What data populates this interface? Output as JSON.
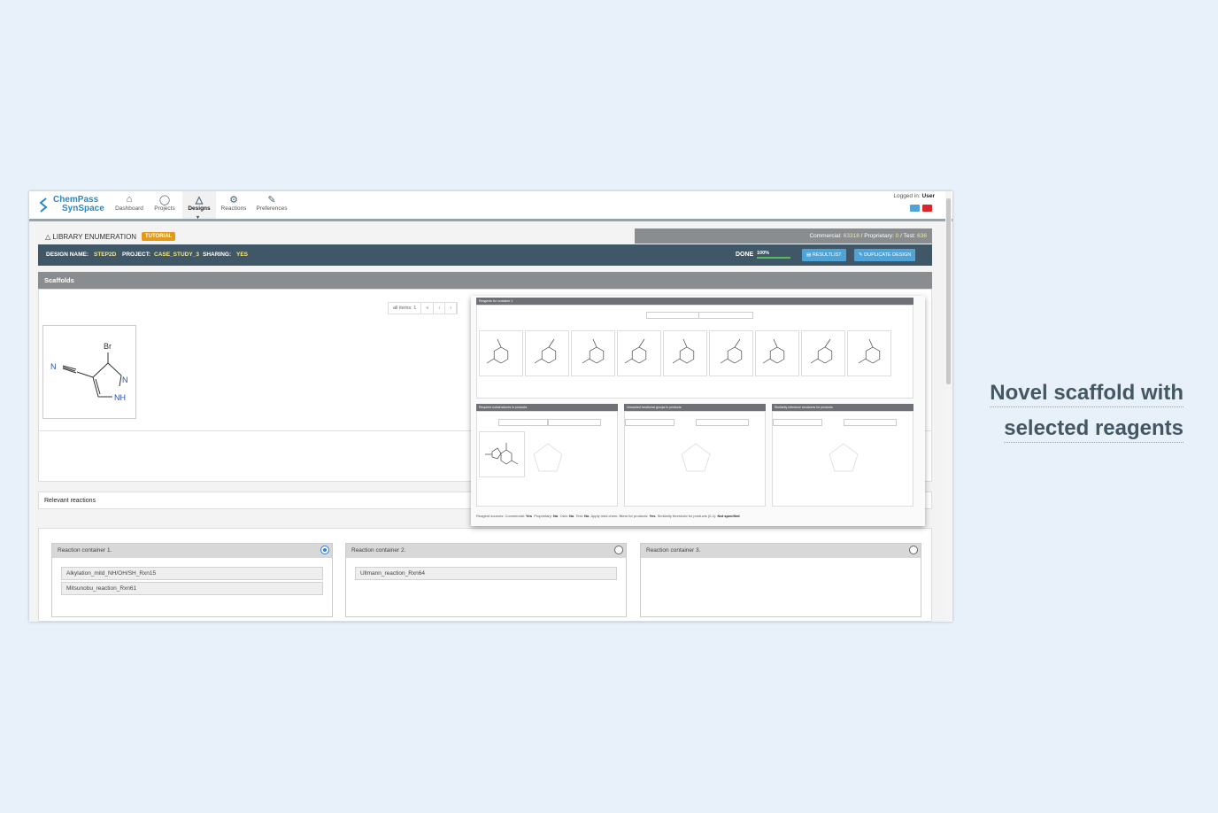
{
  "app": {
    "logo_line1": "ChemPass",
    "logo_line2": "SynSpace",
    "nav": [
      "Dashboard",
      "Projects",
      "Designs",
      "Reactions",
      "Preferences"
    ],
    "active_nav": "Designs",
    "logged_in_label": "Logged in:",
    "logged_in_user": "User"
  },
  "header": {
    "title": "LIBRARY ENUMERATION",
    "tutorial": "TUTORIAL",
    "commercial_label": "Commercial:",
    "commercial_value": "63318",
    "proprietary_label": "/ Proprietary:",
    "proprietary_value": "0",
    "test_label": "/ Test:",
    "test_value": "636"
  },
  "design": {
    "name_label": "DESIGN NAME:",
    "name": "STEP2D",
    "project_label": "PROJECT:",
    "project": "CASE_STUDY_3",
    "sharing_label": "SHARING:",
    "sharing": "YES",
    "status": "DONE",
    "progress_text": "100%",
    "progress_fraction": 1.0,
    "resultlist_btn": "RESULTLIST",
    "duplicate_btn": "DUPLICATE DESIGN"
  },
  "scaffolds": {
    "title": "Scaffolds",
    "pager": [
      "all items: 1",
      "«",
      "‹",
      "›"
    ],
    "molecule_atoms": [
      "Br",
      "N",
      "N",
      "NH"
    ]
  },
  "relevant_title": "Relevant reactions",
  "containers": [
    {
      "title": "Reaction container 1.",
      "selected": true,
      "reactions": [
        "Alkylation_mild_NH/OH/SH_Rxn15",
        "Mitsunobu_reaction_Rxn61"
      ]
    },
    {
      "title": "Reaction container 2.",
      "selected": false,
      "reactions": [
        "Ullmann_reaction_Rxn64"
      ]
    },
    {
      "title": "Reaction container 3.",
      "selected": false,
      "reactions": []
    }
  ],
  "overlay": {
    "reagents_title": "Reagents for container 1",
    "sub_titles": [
      "Required substructures in products",
      "Unwanted functional groups in products",
      "Similarity reference structures for products"
    ],
    "footer": {
      "sources_label": "Reagent sources: Commercial:",
      "commercial": "Yes",
      "proprietary_label": "Proprietary:",
      "proprietary": "No",
      "own_label": "Own:",
      "own": "No",
      "test_label": "Test:",
      "test": "No",
      "filters_label": "Apply med.chem. filters for products:",
      "filters": "Yes",
      "similarity_label": "Similarity threshold for products (0-1):",
      "similarity": "Not specified"
    }
  },
  "caption": {
    "line1": "Novel scaffold with",
    "line2": "selected reagents"
  },
  "colors": {
    "accent": "#2a88c4",
    "design_bar": "#405768",
    "tutorial": "#e19a1b",
    "highlight": "#f3e77b"
  }
}
